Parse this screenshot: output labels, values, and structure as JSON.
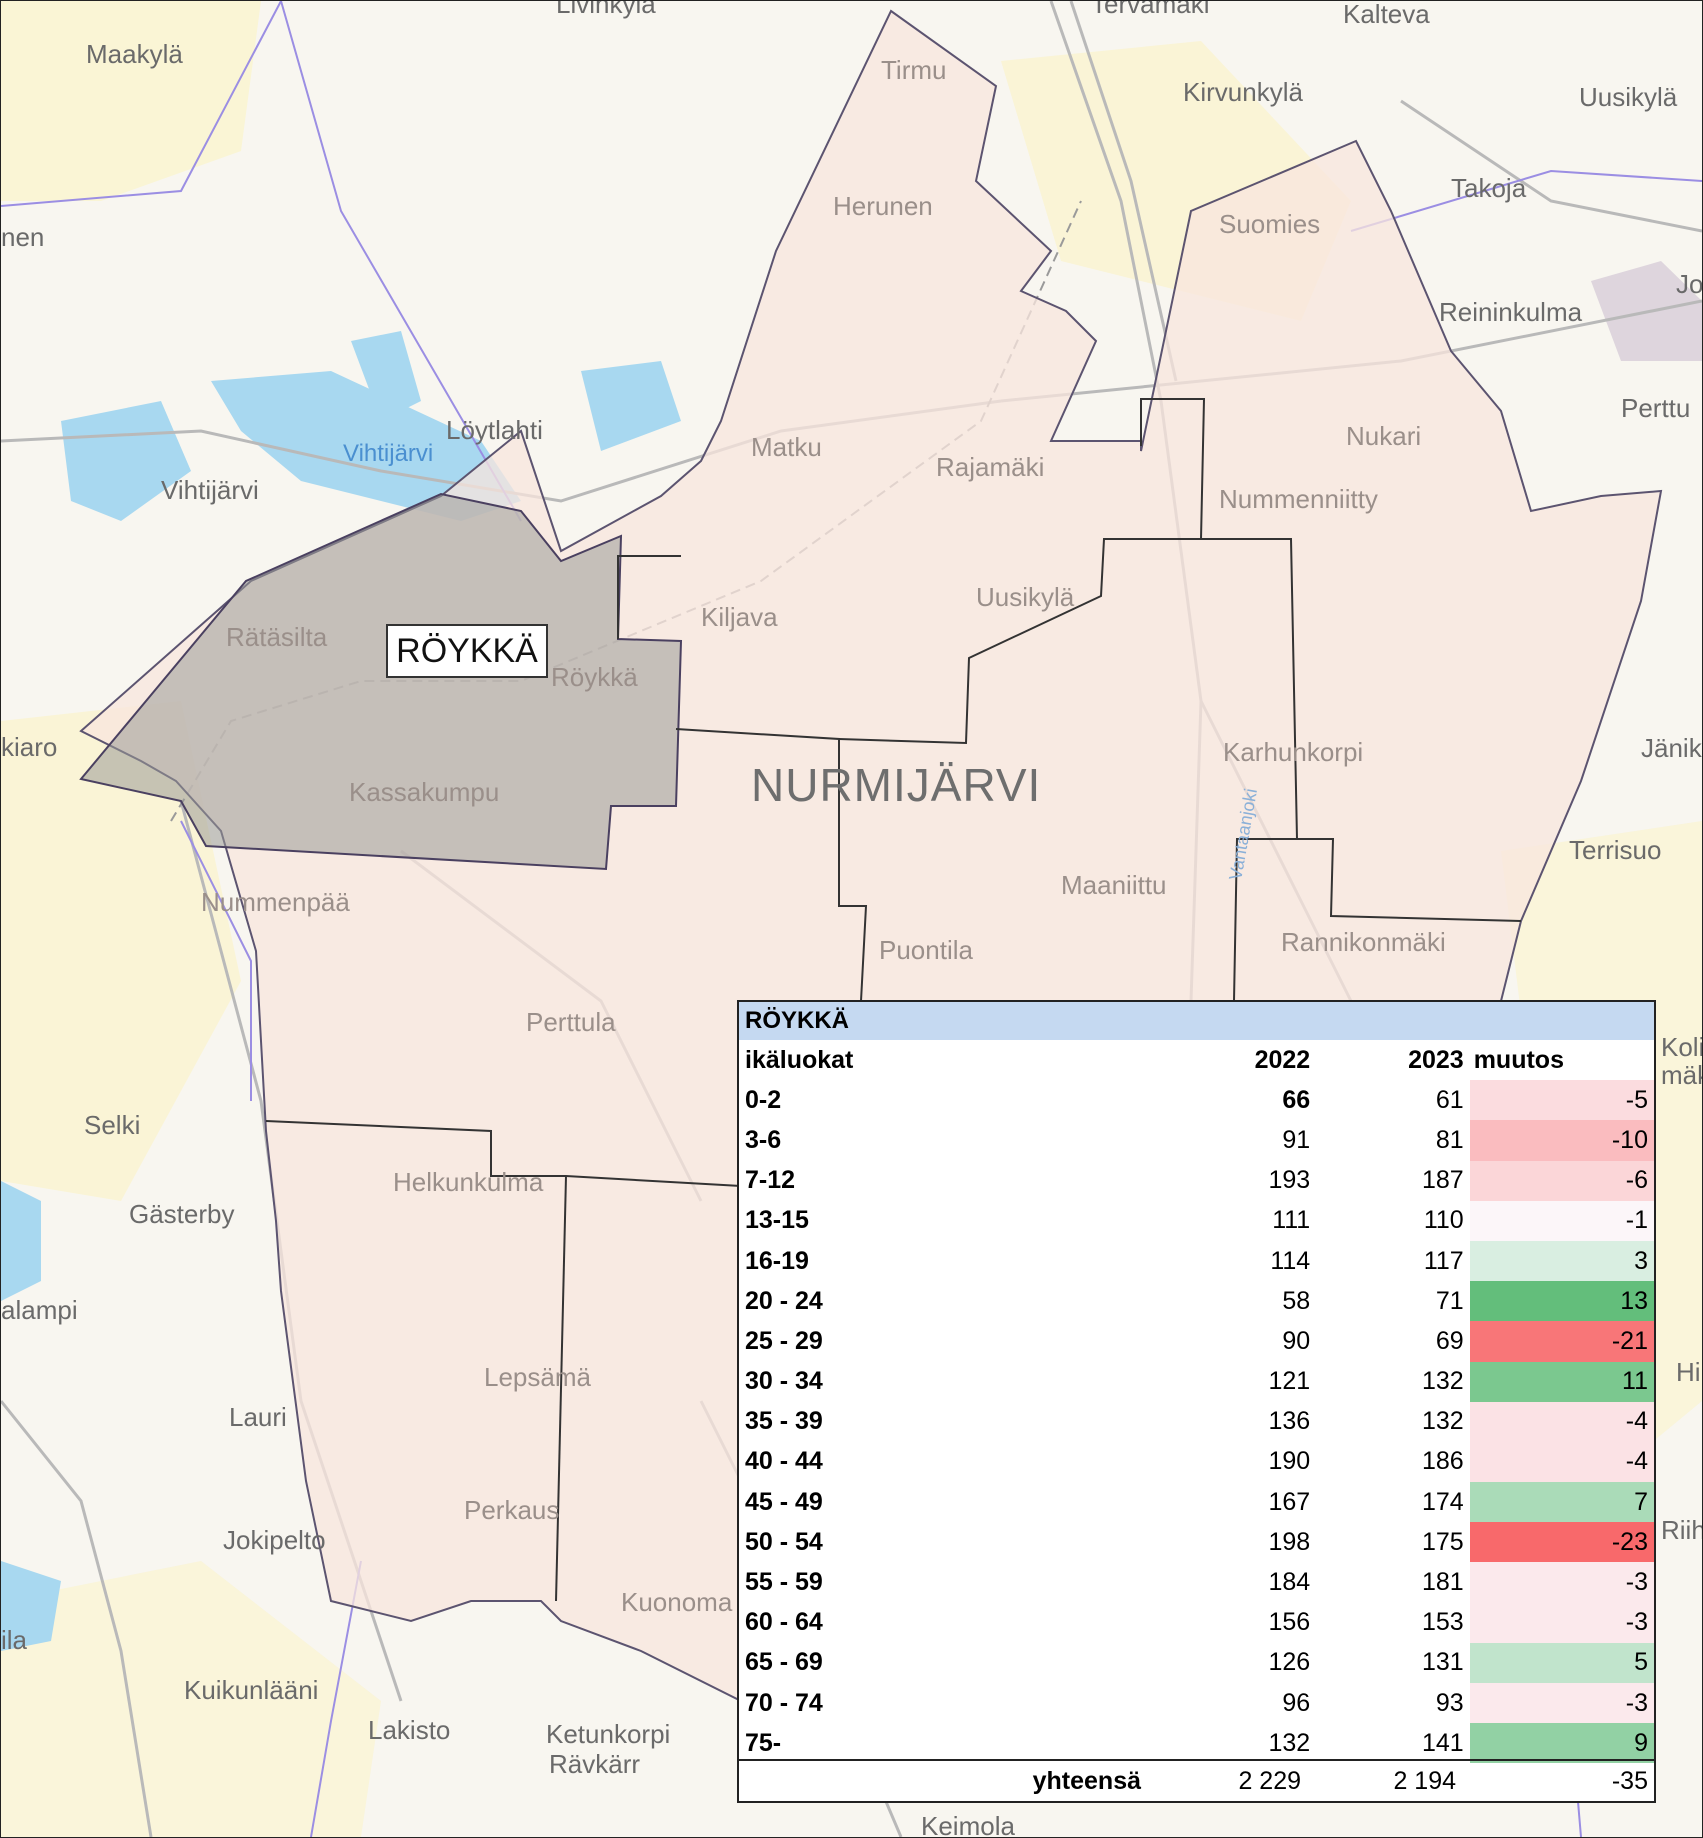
{
  "map": {
    "highlight_label": "RÖYKKÄ",
    "municipality": "NURMIJÄRVI",
    "places": [
      "Maakylä",
      "Kalteva",
      "Kirvunkylä",
      "Uusikylä",
      "Takoja",
      "nen",
      "Tirmu",
      "Herunen",
      "Suomies",
      "Reininkulma",
      "Jo",
      "Perttu",
      "Nukari",
      "Nummenniitty",
      "Löytlahti",
      "Vihtijärvi",
      "Matku",
      "Rajamäki",
      "Uusikylä",
      "Kiljava",
      "Rätäsilta",
      "Röykkä",
      "kiaro",
      "Kassakumpu",
      "Karhunkorpi",
      "Jänik",
      "Terrisuo",
      "Nummenpää",
      "Maaniittu",
      "Puontila",
      "Rannikonmäki",
      "Perttula",
      "Selki",
      "Helkunkulma",
      "Gästerby",
      "alampi",
      "Lepsämä",
      "Lauri",
      "Perkaus",
      "Jokipelto",
      "Kuonoma",
      "ila",
      "Kuikunlääni",
      "Lakisto",
      "Ketunkorpi",
      "Rävkärr",
      "Keimola",
      "Livinkylä",
      "Tervamäki",
      "Koli",
      "mäk",
      "Hi",
      "Riih"
    ],
    "water_labels": [
      "Vihtijärvi"
    ],
    "river_labels": [
      "Vantaanjoki"
    ]
  },
  "table": {
    "title": "RÖYKKÄ",
    "headers": {
      "label": "ikäluokat",
      "y2022": "2022",
      "y2023": "2023",
      "change": "muutos"
    },
    "rows": [
      {
        "label": "0-2",
        "y2022": "66",
        "y2023": "61",
        "change": "-5",
        "change_value": -5
      },
      {
        "label": "3-6",
        "y2022": "91",
        "y2023": "81",
        "change": "-10",
        "change_value": -10
      },
      {
        "label": "7-12",
        "y2022": "193",
        "y2023": "187",
        "change": "-6",
        "change_value": -6
      },
      {
        "label": "13-15",
        "y2022": "111",
        "y2023": "110",
        "change": "-1",
        "change_value": -1
      },
      {
        "label": "16-19",
        "y2022": "114",
        "y2023": "117",
        "change": "3",
        "change_value": 3
      },
      {
        "label": "20 - 24",
        "y2022": "58",
        "y2023": "71",
        "change": "13",
        "change_value": 13
      },
      {
        "label": "25 - 29",
        "y2022": "90",
        "y2023": "69",
        "change": "-21",
        "change_value": -21
      },
      {
        "label": "30 - 34",
        "y2022": "121",
        "y2023": "132",
        "change": "11",
        "change_value": 11
      },
      {
        "label": "35 - 39",
        "y2022": "136",
        "y2023": "132",
        "change": "-4",
        "change_value": -4
      },
      {
        "label": "40 - 44",
        "y2022": "190",
        "y2023": "186",
        "change": "-4",
        "change_value": -4
      },
      {
        "label": "45 - 49",
        "y2022": "167",
        "y2023": "174",
        "change": "7",
        "change_value": 7
      },
      {
        "label": "50 - 54",
        "y2022": "198",
        "y2023": "175",
        "change": "-23",
        "change_value": -23
      },
      {
        "label": "55 - 59",
        "y2022": "184",
        "y2023": "181",
        "change": "-3",
        "change_value": -3
      },
      {
        "label": "60 - 64",
        "y2022": "156",
        "y2023": "153",
        "change": "-3",
        "change_value": -3
      },
      {
        "label": "65 - 69",
        "y2022": "126",
        "y2023": "131",
        "change": "5",
        "change_value": 5
      },
      {
        "label": "70 - 74",
        "y2022": "96",
        "y2023": "93",
        "change": "-3",
        "change_value": -3
      },
      {
        "label": "75-",
        "y2022": "132",
        "y2023": "141",
        "change": "9",
        "change_value": 9
      }
    ],
    "total": {
      "label": "yhteensä",
      "y2022": "2 229",
      "y2023": "2 194",
      "change": "-35"
    },
    "colors": {
      "title_bg": "#c5d9f1",
      "positive_max": "#63be7b",
      "negative_max": "#f8696b",
      "neutral": "#fcfcff"
    }
  }
}
